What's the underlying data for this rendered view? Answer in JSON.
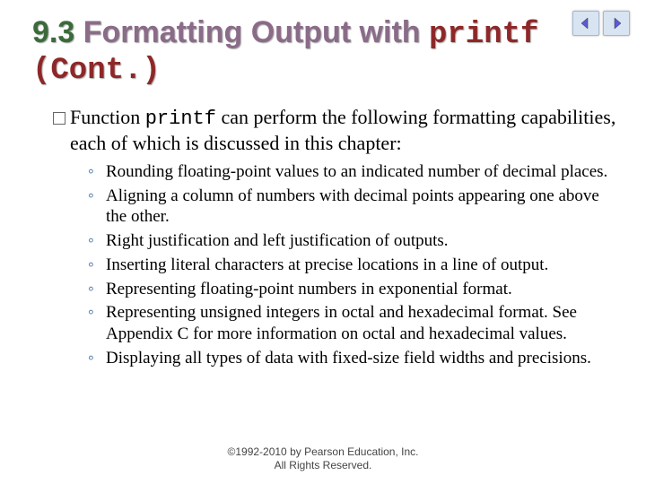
{
  "title": {
    "section_number": "9.3",
    "main": "Formatting Output with",
    "code_word": "printf",
    "cont": "(Cont.)"
  },
  "intro": {
    "prefix": "Function",
    "code_word": "printf",
    "rest": "can perform the following formatting capabilities, each of which is discussed in this chapter:"
  },
  "bullets": [
    "Rounding floating-point values to an indicated number of decimal places.",
    "Aligning a column of numbers with decimal points appearing one above the other.",
    "Right justification and left justification of outputs.",
    "Inserting literal characters at precise locations in a line of output.",
    "Representing floating-point numbers in exponential format.",
    "Representing unsigned integers in octal and hexadecimal format. See Appendix C for more information on octal and hexadecimal values.",
    "Displaying all types of data with fixed-size field widths and precisions."
  ],
  "copyright": {
    "line1": "©1992-2010 by Pearson Education, Inc.",
    "line2": "All Rights Reserved."
  },
  "nav": {
    "prev_label": "previous",
    "next_label": "next"
  }
}
